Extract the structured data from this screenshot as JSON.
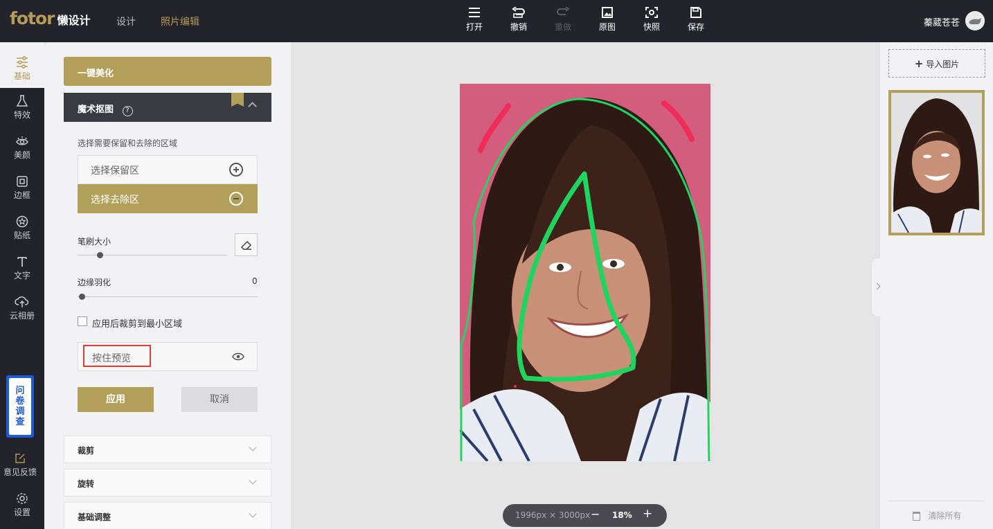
{
  "app": {
    "logo_text": "fotor",
    "logo_sub": "懒设计",
    "nav": [
      "设计",
      "照片编辑"
    ],
    "user_name": "蓁葳苍苍"
  },
  "toolbar": {
    "open": "打开",
    "undo": "撤销",
    "redo": "重做",
    "original": "原图",
    "snapshot": "快照",
    "save": "保存"
  },
  "rail": {
    "items": [
      "基础",
      "特效",
      "美颜",
      "边框",
      "贴纸",
      "文字",
      "云相册"
    ],
    "survey": [
      "问",
      "卷",
      "调",
      "查"
    ],
    "feedback": "意见反馈",
    "settings": "设置"
  },
  "panel": {
    "beautify": "一键美化",
    "magic_cutout": "魔术抠图",
    "help": "?",
    "hint": "选择需要保留和去除的区域",
    "keep_area": "选择保留区",
    "remove_area": "选择去除区",
    "brush_size": "笔刷大小",
    "brush_size_value": 0.15,
    "feather": "边缘羽化",
    "feather_value": "0",
    "crop_min": "应用后裁剪到最小区域",
    "crop_min_checked": false,
    "hold_preview": "按住预览",
    "apply": "应用",
    "cancel": "取消",
    "accordions": [
      "裁剪",
      "旋转",
      "基础调整"
    ]
  },
  "canvas": {
    "dims": "1996px × 3000px",
    "zoom_minus": "−",
    "zoom": "18%",
    "zoom_plus": "+"
  },
  "right": {
    "import": "导入图片",
    "clear_all": "清除所有"
  },
  "colors": {
    "accent": "#b2a05a",
    "dark": "#23232b",
    "keep_stroke": "#1fd45f",
    "remove_stroke": "#ef2c5a"
  }
}
